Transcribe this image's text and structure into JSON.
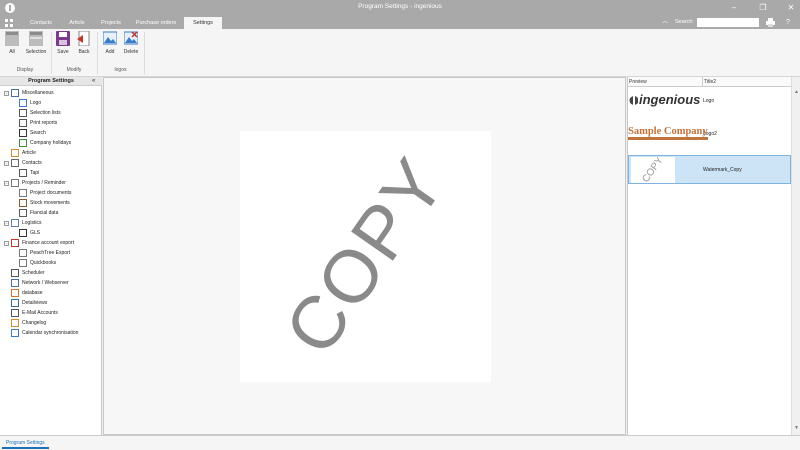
{
  "window": {
    "title": "Program Settings - ingenious"
  },
  "tabs": [
    {
      "label": "Contacts"
    },
    {
      "label": "Article"
    },
    {
      "label": "Projects"
    },
    {
      "label": "Purchase orders"
    },
    {
      "label": "Settings"
    }
  ],
  "search": {
    "label": "Search:",
    "value": ""
  },
  "ribbon": {
    "all": "All",
    "selection": "Selection",
    "save": "Save",
    "back": "Back",
    "add": "Add",
    "delete": "Delete",
    "group_display": "Display",
    "group_modify": "Modify",
    "group_logos": "logos"
  },
  "leftpanel": {
    "header": "Program Settings",
    "collapse_glyph": "«",
    "tree": [
      {
        "label": "Miscellaneous",
        "icon": "settings-icon"
      },
      {
        "label": "Logo",
        "icon": "image-icon"
      },
      {
        "label": "Selection lists",
        "icon": "list-icon"
      },
      {
        "label": "Print reports",
        "icon": "printer-icon"
      },
      {
        "label": "Search",
        "icon": "binoculars-icon"
      },
      {
        "label": "Company holidays",
        "icon": "palm-icon"
      },
      {
        "label": "Article",
        "icon": "box-icon"
      },
      {
        "label": "Contacts",
        "icon": "person-icon"
      },
      {
        "label": "Tapi",
        "icon": "phone-icon"
      },
      {
        "label": "Projects / Reminder",
        "icon": "document-icon"
      },
      {
        "label": "Project documents",
        "icon": "document-icon"
      },
      {
        "label": "Stock movements",
        "icon": "stock-icon"
      },
      {
        "label": "Fiancial data",
        "icon": "finance-icon"
      },
      {
        "label": "Logistics",
        "icon": "truck-icon"
      },
      {
        "label": "GLS",
        "icon": "barcode-icon"
      },
      {
        "label": "Finance account export",
        "icon": "export-icon"
      },
      {
        "label": "PeachTree Export",
        "icon": "document-icon"
      },
      {
        "label": "Quickbooks",
        "icon": "document-icon"
      },
      {
        "label": "Scheduler",
        "icon": "clock-icon"
      },
      {
        "label": "Network / Webserver",
        "icon": "network-icon"
      },
      {
        "label": "database",
        "icon": "database-icon"
      },
      {
        "label": "Detailviews",
        "icon": "grid-icon"
      },
      {
        "label": "E-Mail Accounts",
        "icon": "mail-icon"
      },
      {
        "label": "Changelog",
        "icon": "changelog-icon"
      },
      {
        "label": "Calendar synchronisation",
        "icon": "calendar-icon"
      }
    ]
  },
  "center": {
    "watermark": "COPY"
  },
  "rightpanel": {
    "col_preview": "Preview",
    "col_title": "Title2",
    "logos": [
      {
        "preview_text": "ingenious",
        "title": "Logo"
      },
      {
        "preview_text": "Sample Company",
        "title": "Logo2"
      },
      {
        "preview_text": "COPY",
        "title": "Watermark_Copy"
      }
    ]
  },
  "statusbar": {
    "tab": "Program Settings"
  },
  "colors": {
    "chrome": "#a9a9a9",
    "selection": "#cde4f7",
    "accent": "#1e6fb8",
    "sample_company": "#c0733a"
  }
}
